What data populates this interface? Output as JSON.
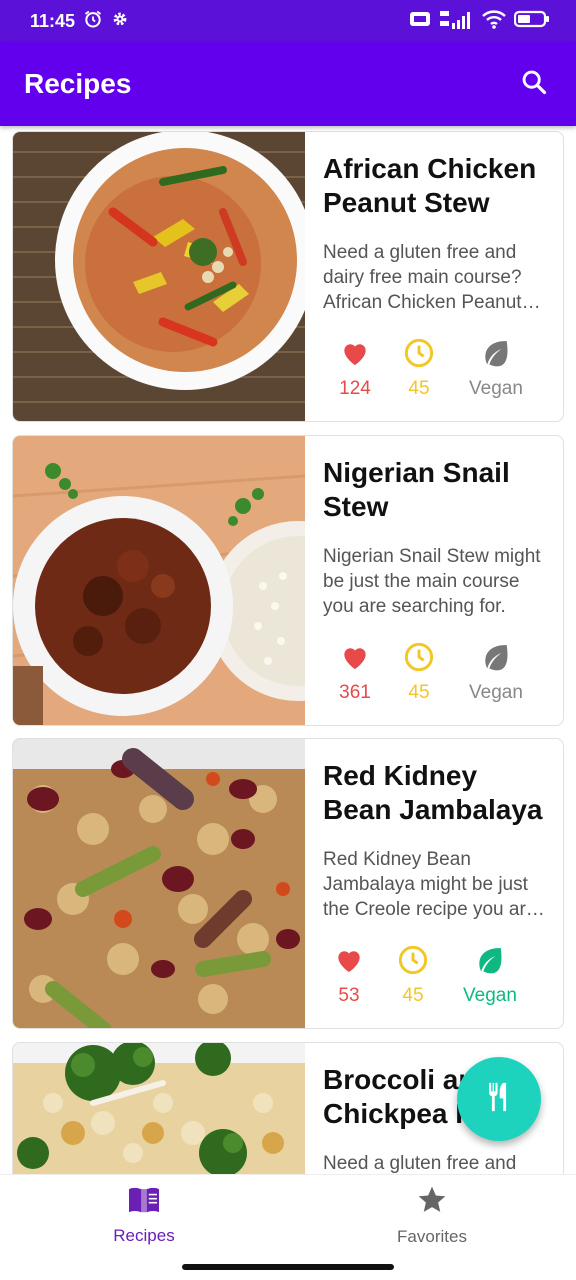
{
  "status_bar": {
    "time": "11:45"
  },
  "app_bar": {
    "title": "Recipes"
  },
  "recipes": [
    {
      "title": "African Chicken Peanut Stew",
      "description": "Need a gluten free and dairy free main course? African Chicken Peanut Stew could be a super recipe to try.",
      "likes": "124",
      "minutes": "45",
      "vegan_label": "Vegan",
      "vegan": false
    },
    {
      "title": "Nigerian Snail Stew",
      "description": "Nigerian Snail Stew might be just the main course you are searching for.",
      "likes": "361",
      "minutes": "45",
      "vegan_label": "Vegan",
      "vegan": false
    },
    {
      "title": "Red Kidney Bean Jambalaya",
      "description": "Red Kidney Bean Jambalaya might be just the Creole recipe you are searching for.",
      "likes": "53",
      "minutes": "45",
      "vegan_label": "Vegan",
      "vegan": true
    },
    {
      "title": "Broccoli and Chickpea Rice",
      "description": "Need a gluten free and",
      "likes": "",
      "minutes": "",
      "vegan_label": "",
      "vegan": false
    }
  ],
  "bottom_nav": {
    "recipes_label": "Recipes",
    "favorites_label": "Favorites"
  },
  "colors": {
    "primary": "#6200ee",
    "status_bar": "#5c11d9",
    "fab": "#1ed3be",
    "heart": "#e84a4a",
    "clock": "#f2c624",
    "vegan": "#0fb882",
    "nav_active": "#6a1fb5"
  },
  "icons": {
    "search": "search-icon",
    "fab": "restaurant-icon",
    "recipes_nav": "menu-book-icon",
    "favorites_nav": "star-icon"
  }
}
